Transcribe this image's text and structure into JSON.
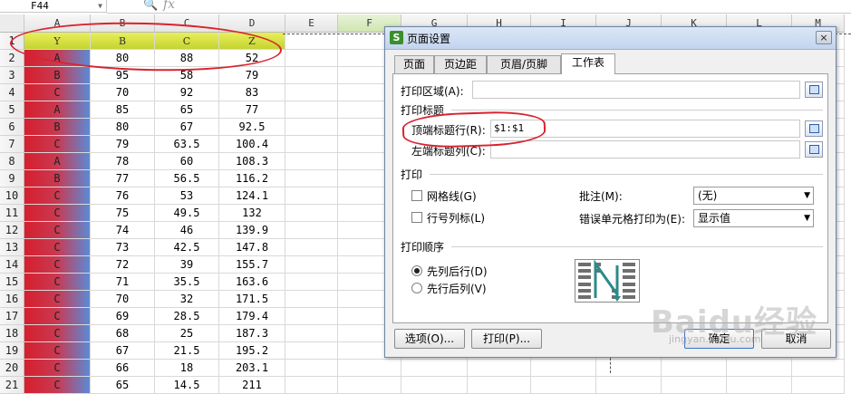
{
  "formula_bar": {
    "cell_ref": "F44",
    "fx": "fx"
  },
  "columns": [
    "A",
    "B",
    "C",
    "D",
    "E",
    "F",
    "G",
    "H",
    "I",
    "J",
    "K",
    "L",
    "M"
  ],
  "header_row": {
    "row": "1",
    "cells": [
      "Y",
      "B",
      "C",
      "Z"
    ]
  },
  "rows": [
    {
      "row": "2",
      "a": "A",
      "b": "80",
      "c": "88",
      "d": "52"
    },
    {
      "row": "3",
      "a": "B",
      "b": "95",
      "c": "58",
      "d": "79"
    },
    {
      "row": "4",
      "a": "C",
      "b": "70",
      "c": "92",
      "d": "83"
    },
    {
      "row": "5",
      "a": "A",
      "b": "85",
      "c": "65",
      "d": "77"
    },
    {
      "row": "6",
      "a": "B",
      "b": "80",
      "c": "67",
      "d": "92.5"
    },
    {
      "row": "7",
      "a": "C",
      "b": "79",
      "c": "63.5",
      "d": "100.4"
    },
    {
      "row": "8",
      "a": "A",
      "b": "78",
      "c": "60",
      "d": "108.3"
    },
    {
      "row": "9",
      "a": "B",
      "b": "77",
      "c": "56.5",
      "d": "116.2"
    },
    {
      "row": "10",
      "a": "C",
      "b": "76",
      "c": "53",
      "d": "124.1"
    },
    {
      "row": "11",
      "a": "C",
      "b": "75",
      "c": "49.5",
      "d": "132"
    },
    {
      "row": "12",
      "a": "C",
      "b": "74",
      "c": "46",
      "d": "139.9"
    },
    {
      "row": "13",
      "a": "C",
      "b": "73",
      "c": "42.5",
      "d": "147.8"
    },
    {
      "row": "14",
      "a": "C",
      "b": "72",
      "c": "39",
      "d": "155.7"
    },
    {
      "row": "15",
      "a": "C",
      "b": "71",
      "c": "35.5",
      "d": "163.6"
    },
    {
      "row": "16",
      "a": "C",
      "b": "70",
      "c": "32",
      "d": "171.5"
    },
    {
      "row": "17",
      "a": "C",
      "b": "69",
      "c": "28.5",
      "d": "179.4"
    },
    {
      "row": "18",
      "a": "C",
      "b": "68",
      "c": "25",
      "d": "187.3"
    },
    {
      "row": "19",
      "a": "C",
      "b": "67",
      "c": "21.5",
      "d": "195.2"
    },
    {
      "row": "20",
      "a": "C",
      "b": "66",
      "c": "18",
      "d": "203.1"
    },
    {
      "row": "21",
      "a": "C",
      "b": "65",
      "c": "14.5",
      "d": "211"
    }
  ],
  "dialog": {
    "title": "页面设置",
    "close": "×",
    "tabs": [
      "页面",
      "页边距",
      "页眉/页脚",
      "工作表"
    ],
    "print_area_label": "打印区域(A):",
    "print_titles_section": "打印标题",
    "top_rows_label": "顶端标题行(R):",
    "top_rows_value": "$1:$1",
    "left_cols_label": "左端标题列(C):",
    "print_section": "打印",
    "gridlines_label": "网格线(G)",
    "row_col_headers_label": "行号列标(L)",
    "comments_label": "批注(M):",
    "comments_value": "(无)",
    "errors_label": "错误单元格打印为(E):",
    "errors_value": "显示值",
    "order_section": "打印顺序",
    "down_then_over": "先列后行(D)",
    "over_then_down": "先行后列(V)",
    "options_button": "选项(O)...",
    "print_button": "打印(P)...",
    "ok_button": "确定",
    "cancel_button": "取消"
  },
  "watermark": {
    "brand": "Baidu经验",
    "url": "jingyan.baidu.com"
  },
  "colors": {
    "annotation": "#d9232f",
    "header_fill": "#d8e03f",
    "col_a_fill": "#d61e2d"
  }
}
